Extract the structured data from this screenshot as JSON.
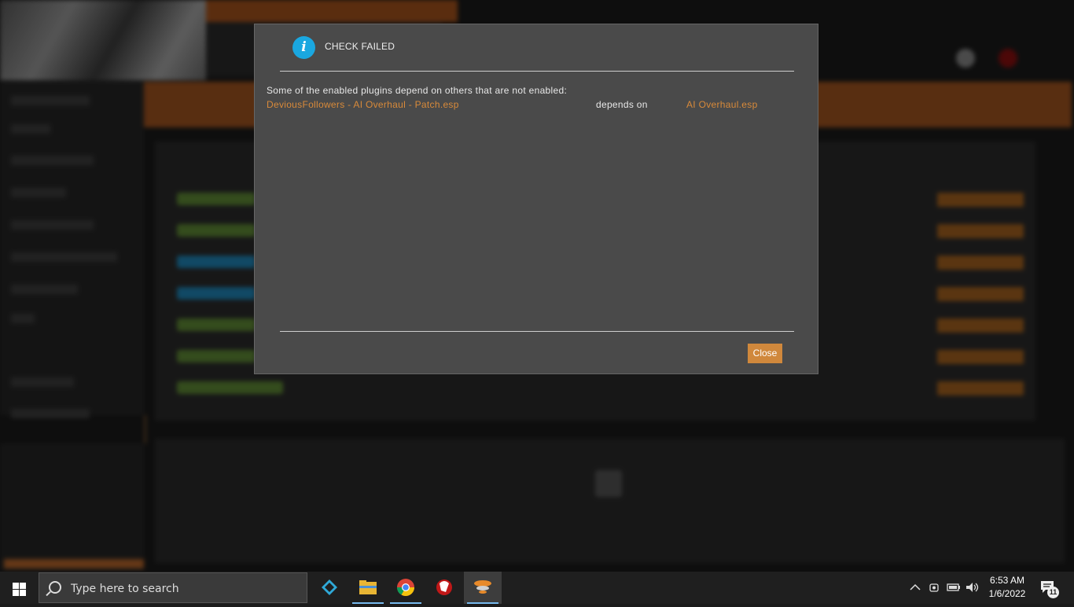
{
  "modal": {
    "title": "CHECK FAILED",
    "message": "Some of the enabled plugins depend on others that are not enabled:",
    "dependencies": [
      {
        "plugin": "DeviousFollowers - AI Overhaul - Patch.esp",
        "relation": "depends on",
        "requires": "AI Overhaul.esp"
      }
    ],
    "close_label": "Close",
    "info_glyph": "i"
  },
  "taskbar": {
    "search_placeholder": "Type here to search",
    "time": "6:53 AM",
    "date": "1/6/2022",
    "notification_count": "11"
  },
  "colors": {
    "accent_orange": "#d0883c",
    "link_orange": "#d88a3a",
    "info_blue": "#1aa7e0"
  }
}
